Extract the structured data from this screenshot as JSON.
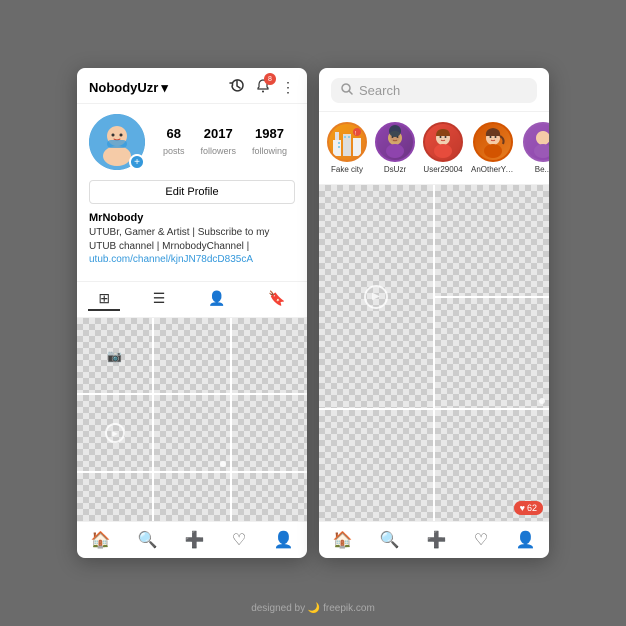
{
  "left_phone": {
    "username": "NobodyUzr",
    "dropdown_icon": "▾",
    "header_icons": {
      "history": "⟲",
      "notification_count": "8",
      "more": "⋮"
    },
    "stats": [
      {
        "value": "68",
        "label": "posts"
      },
      {
        "value": "2017",
        "label": "followers"
      },
      {
        "value": "1987",
        "label": "following"
      }
    ],
    "edit_button": "Edit Profile",
    "bio_name": "MrNobody",
    "bio_text": "UTUBr, Gamer & Artist | Subscribe to my UTUB channel | MrnobodyChannel |",
    "bio_link": "utub.com/channel/kjnJN78dcD835cA",
    "nav_items": [
      "🏠",
      "🔍",
      "➕",
      "♡",
      "👤"
    ]
  },
  "right_phone": {
    "search_placeholder": "Search",
    "stories": [
      {
        "name": "Fake city",
        "color": "city"
      },
      {
        "name": "DsUzr",
        "color": "dark"
      },
      {
        "name": "User29004",
        "color": "red"
      },
      {
        "name": "AnOtherYouser",
        "color": "brown"
      },
      {
        "name": "Be...",
        "color": "purple"
      }
    ],
    "like_count": "62",
    "nav_items": [
      "🏠",
      "🔍",
      "➕",
      "♡",
      "👤"
    ]
  },
  "watermark": "designed by 🌙 freepik.com"
}
